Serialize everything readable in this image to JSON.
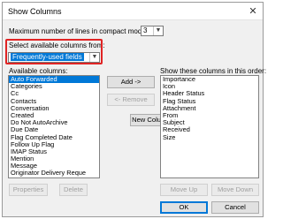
{
  "window": {
    "title": "Show Columns",
    "close_glyph": "✕"
  },
  "compact": {
    "label": "Maximum number of lines in compact mode:",
    "value": "3"
  },
  "select_from": {
    "label": "Select available columns from:",
    "value": "Frequently-used fields"
  },
  "available": {
    "label": "Available columns:",
    "items": [
      "Auto Forwarded",
      "Categories",
      "Cc",
      "Contacts",
      "Conversation",
      "Created",
      "Do Not AutoArchive",
      "Due Date",
      "Flag Completed Date",
      "Follow Up Flag",
      "IMAP Status",
      "Mention",
      "Message",
      "Originator Delivery Reque"
    ],
    "selected_index": 0
  },
  "shown": {
    "label": "Show these columns in this order:",
    "items": [
      "Importance",
      "Icon",
      "Header Status",
      "Flag Status",
      "Attachment",
      "From",
      "Subject",
      "Received",
      "Size"
    ]
  },
  "buttons": {
    "add": "Add ->",
    "remove": "<- Remove",
    "new_column": "New Column...",
    "properties": "Properties",
    "delete": "Delete",
    "move_up": "Move Up",
    "move_down": "Move Down",
    "ok": "OK",
    "cancel": "Cancel"
  },
  "colors": {
    "accent": "#0078d7",
    "highlight_box": "#e02424"
  }
}
